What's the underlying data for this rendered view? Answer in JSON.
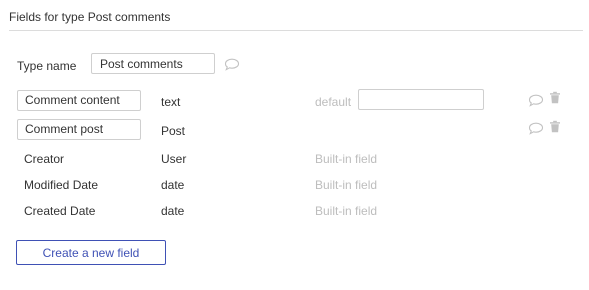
{
  "header": {
    "title": "Fields for type Post comments"
  },
  "type_name": {
    "label": "Type name",
    "value": "Post comments"
  },
  "fields": [
    {
      "name": "Comment content",
      "type": "text",
      "default_label": "default",
      "default_value": ""
    },
    {
      "name": "Comment post",
      "type": "Post"
    }
  ],
  "builtin_fields": [
    {
      "name": "Creator",
      "type": "User",
      "note": "Built-in field"
    },
    {
      "name": "Modified Date",
      "type": "date",
      "note": "Built-in field"
    },
    {
      "name": "Created Date",
      "type": "date",
      "note": "Built-in field"
    }
  ],
  "actions": {
    "create_label": "Create a new field"
  },
  "icons": {
    "comment": "speech-bubble-icon",
    "delete": "trash-icon"
  },
  "colors": {
    "accent": "#3f51b5",
    "muted": "#bdbdbd",
    "icon": "#c2c2c2"
  }
}
